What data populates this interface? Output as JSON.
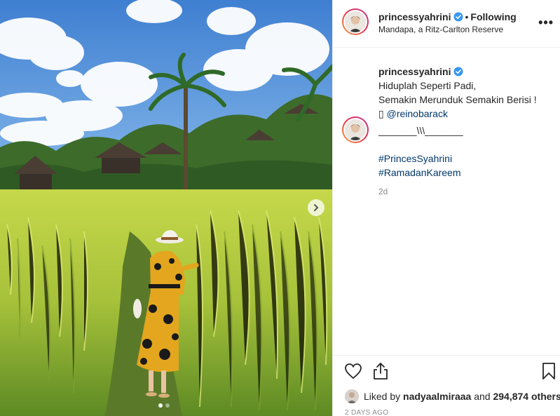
{
  "post": {
    "username": "princessyahrini",
    "following_label": "Following",
    "separator": "•",
    "location": "Mandapa, a Ritz-Carlton Reserve",
    "more_label": "•••"
  },
  "caption": {
    "username": "princessyahrini",
    "lines": [
      "Hiduplah Seperti Padi,",
      "Semakin Merunduk Semakin Berisi !"
    ],
    "mention_prefix": "▯",
    "mention": "@reinobarack"
  },
  "comment": {
    "text": "_______\\\\\\_______"
  },
  "hashtags": [
    "#PrincesSyahrini",
    "#RamadanKareem"
  ],
  "caption_time": "2d",
  "likes": {
    "prefix": "Liked by",
    "user": "nadyaalmiraaa",
    "and": "and",
    "count": "294,874 others"
  },
  "time_ago": "2 DAYS AGO",
  "carousel": {
    "total": 2,
    "active": 1
  },
  "icons": {
    "verified": "verified-badge-icon",
    "like": "heart-icon",
    "share": "share-icon",
    "save": "bookmark-icon",
    "next": "chevron-right-icon"
  },
  "colors": {
    "link": "#00376b",
    "verified": "#3897f0",
    "muted": "#8e8e8e",
    "story_ring": "#e8334c"
  }
}
